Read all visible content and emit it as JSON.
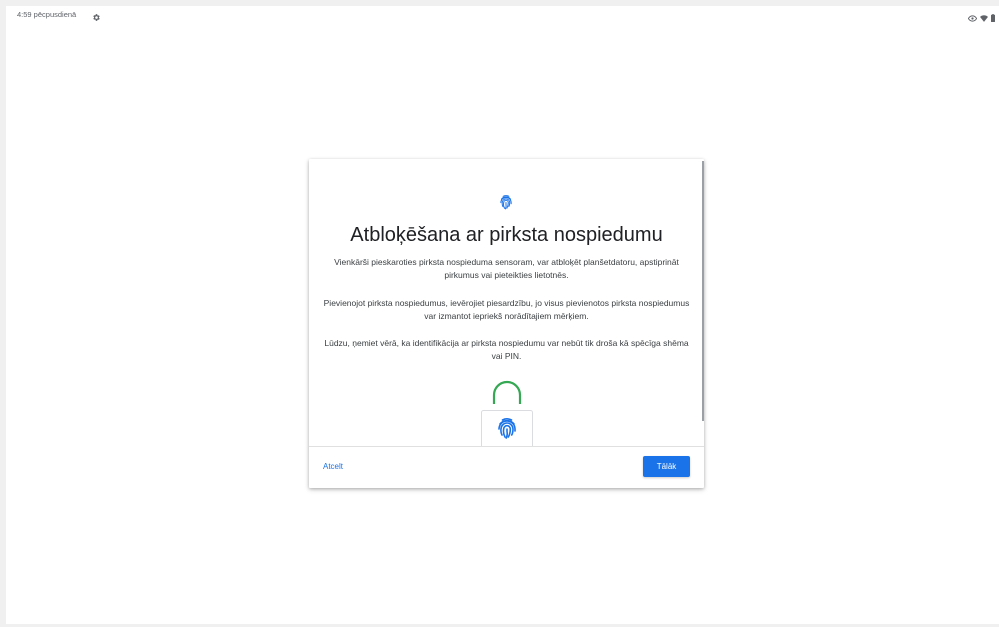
{
  "statusbar": {
    "time": "4:59 pēcpusdienā",
    "left_icon": "gear-icon",
    "right_icons": [
      "eye-icon",
      "wifi-icon",
      "battery-icon"
    ]
  },
  "dialog": {
    "header_icon": "fingerprint-icon",
    "title": "Atbloķēšana ar pirksta nospiedumu",
    "paragraph_1": "Vienkārši pieskaroties pirksta nospieduma sensoram, var atbloķēt planšetdatoru, apstiprināt pirkumus vai pieteikties lietotnēs.",
    "paragraph_2": "Pievienojot pirksta nospiedumus, ievērojiet piesardzību, jo visus pievienotos pirksta nospiedumus var izmantot iepriekš norādītajiem mērķiem.",
    "paragraph_3": "Lūdzu, ņemiet vērā, ka identifikācija ar pirksta nospiedumu var nebūt tik droša kā spēcīga shēma vai PIN.",
    "illustration": "unlocked-padlock-fingerprint-icon",
    "cancel_label": "Atcelt",
    "next_label": "Tālāk"
  },
  "colors": {
    "accent": "#1a73e8",
    "lock_shackle": "#34a853",
    "text_primary": "#202124",
    "text_secondary": "#3c4043"
  }
}
